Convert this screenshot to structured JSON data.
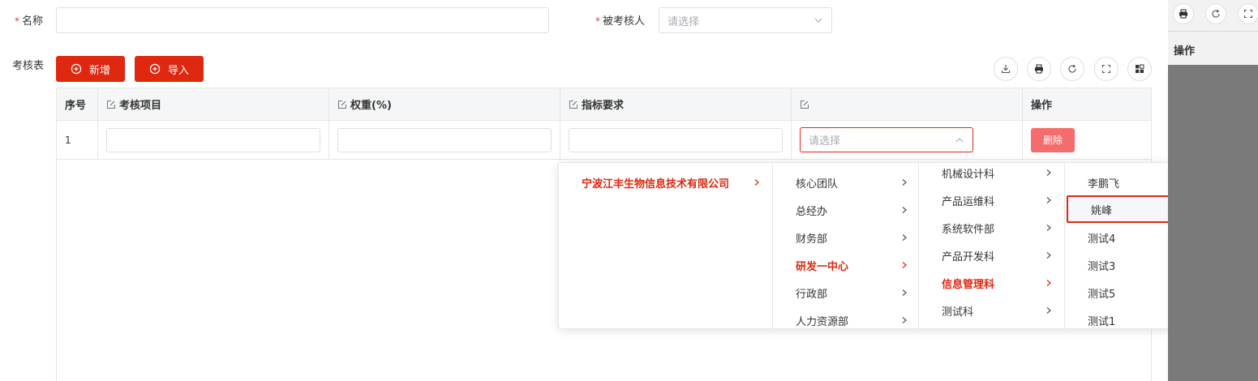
{
  "form": {
    "name_required": "*",
    "name_label": "名称",
    "assessee_required": "*",
    "assessee_label": "被考核人",
    "assessee_placeholder": "请选择"
  },
  "section": {
    "label": "考核表",
    "add_label": "新增",
    "import_label": "导入"
  },
  "toolbar": {
    "icons": [
      "download-icon",
      "print-icon",
      "refresh-icon",
      "fullscreen-icon",
      "grid-icon"
    ]
  },
  "table": {
    "headers": [
      "序号",
      "考核项目",
      "权重(%)",
      "指标要求",
      "",
      "操作"
    ],
    "rows": [
      {
        "index": "1",
        "select_placeholder": "请选择",
        "action": "删除"
      }
    ]
  },
  "cascader": {
    "level1": [
      {
        "label": "宁波江丰生物信息技术有限公司",
        "active": true
      }
    ],
    "level2": [
      {
        "label": "核心团队",
        "active": false
      },
      {
        "label": "总经办",
        "active": false
      },
      {
        "label": "财务部",
        "active": false
      },
      {
        "label": "研发一中心",
        "active": true
      },
      {
        "label": "行政部",
        "active": false
      },
      {
        "label": "人力资源部",
        "active": false
      }
    ],
    "level3": [
      {
        "label": "机械设计科",
        "active": false
      },
      {
        "label": "产品运维科",
        "active": false
      },
      {
        "label": "系统软件部",
        "active": false
      },
      {
        "label": "产品开发科",
        "active": false
      },
      {
        "label": "信息管理科",
        "active": true
      },
      {
        "label": "测试科",
        "active": false
      }
    ],
    "level4": [
      {
        "label": "李鹏飞",
        "highlighted": false
      },
      {
        "label": "姚峰",
        "highlighted": true
      },
      {
        "label": "测试4",
        "highlighted": false
      },
      {
        "label": "测试3",
        "highlighted": false
      },
      {
        "label": "测试5",
        "highlighted": false
      },
      {
        "label": "测试1",
        "highlighted": false
      }
    ]
  },
  "side_panel": {
    "header": "操作"
  },
  "colors": {
    "primary": "#e0270f",
    "danger_light": "#f56c6c",
    "highlight_box": "#e0270f"
  }
}
